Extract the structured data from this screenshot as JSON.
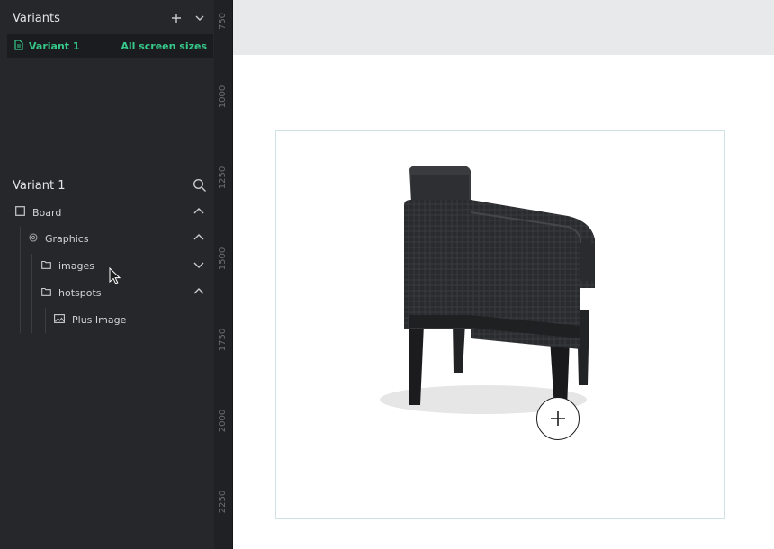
{
  "variants_panel": {
    "title": "Variants",
    "items": [
      {
        "label": "Variant 1",
        "screens": "All screen sizes"
      }
    ]
  },
  "layers_panel": {
    "title": "Variant 1",
    "tree": [
      {
        "label": "Board",
        "icon": "board-icon",
        "chevron": "up"
      },
      {
        "label": "Graphics",
        "icon": "graphics-icon",
        "chevron": "up"
      },
      {
        "label": "images",
        "icon": "folder-icon",
        "chevron": "down"
      },
      {
        "label": "hotspots",
        "icon": "folder-icon",
        "chevron": "up"
      },
      {
        "label": "Plus Image",
        "icon": "image-icon",
        "chevron": ""
      }
    ]
  },
  "ruler": {
    "labels": [
      "750",
      "1000",
      "1250",
      "1500",
      "1750",
      "2000",
      "2250"
    ]
  },
  "colors": {
    "panel_bg": "#25272b",
    "accent_green": "#36c98a",
    "canvas_topbar": "#e8e9ea"
  }
}
